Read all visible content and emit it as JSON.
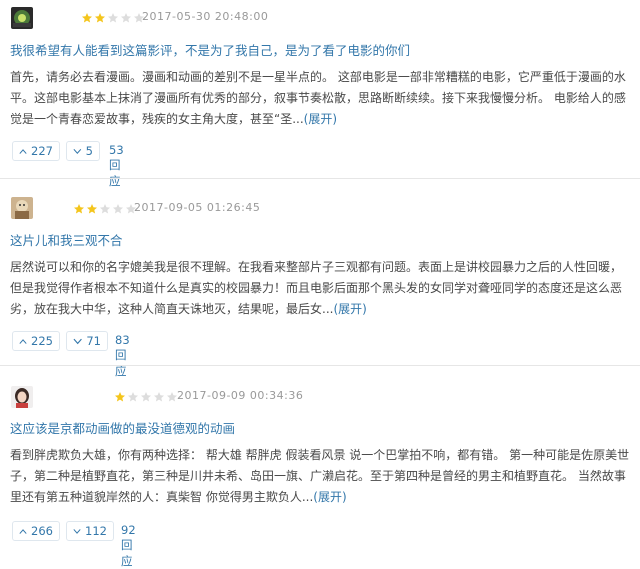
{
  "colors": {
    "link": "#3377aa",
    "star_on": "#f4c51c",
    "star_off": "#dddddd"
  },
  "reviews": [
    {
      "rating": 2,
      "time": "2017-05-30 20:48:00",
      "title": "我很希望有人能看到这篇影评，不是为了我自己，是为了看了电影的你们",
      "body": "首先，请务必去看漫画。漫画和动画的差别不是一星半点的。 这部电影是一部非常糟糕的电影，它严重低于漫画的水平。这部电影基本上抹消了漫画所有优秀的部分，叙事节奏松散，思路断断续续。接下来我慢慢分析。 电影给人的感觉是一个青春恋爱故事，残疾的女主角大度，甚至“圣...",
      "more": "(展开)",
      "up": "227",
      "down": "5",
      "replies": "53回应"
    },
    {
      "rating": 2,
      "time": "2017-09-05 01:26:45",
      "title": "这片儿和我三观不合",
      "body": "居然说可以和你的名字媲美我是很不理解。在我看来整部片子三观都有问题。表面上是讲校园暴力之后的人性回暖，但是我觉得作者根本不知道什么是真实的校园暴力！而且电影后面那个黑头发的女同学对聋哑同学的态度还是这么恶劣，放在我大中华，这种人简直天诛地灭，结果呢，最后女...",
      "more": "(展开)",
      "up": "225",
      "down": "71",
      "replies": "83回应"
    },
    {
      "rating": 1,
      "time": "2017-09-09 00:34:36",
      "title": "这应该是京都动画做的最没道德观的动画",
      "body": "看到胖虎欺负大雄，你有两种选择： 帮大雄 帮胖虎 假装看风景 说一个巴掌拍不响，都有错。 第一种可能是佐原美世子，第二种是植野直花，第三种是川井未希、岛田一旗、广濑启花。至于第四种是曾经的男主和植野直花。 当然故事里还有第五种道貌岸然的人：真柴智 你觉得男主欺负人...",
      "more": "(展开)",
      "up": "266",
      "down": "112",
      "replies": "92回应"
    }
  ]
}
